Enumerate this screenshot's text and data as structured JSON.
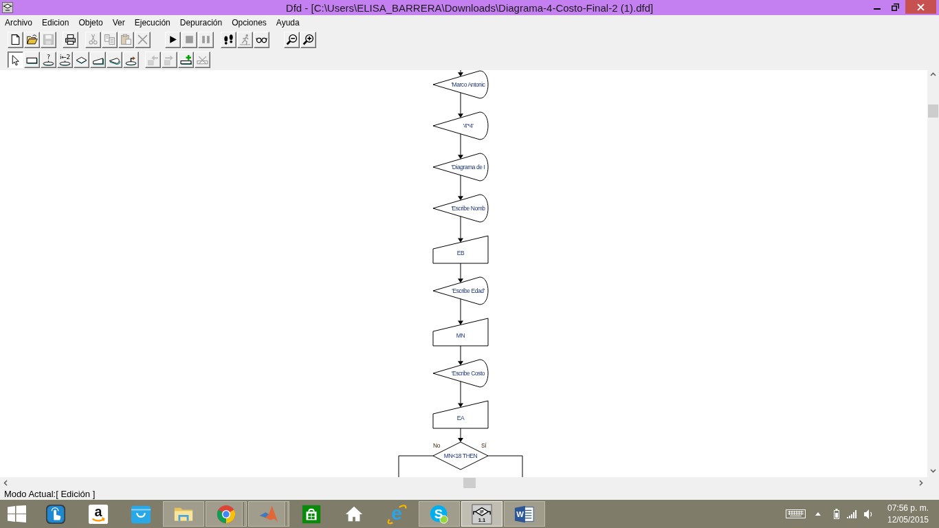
{
  "window": {
    "title": "Dfd - [C:\\Users\\ELISA_BARRERA\\Downloads\\Diagrama-4-Costo-Final-2 (1).dfd]"
  },
  "menu": [
    "Archivo",
    "Edicion",
    "Objeto",
    "Ver",
    "Ejecución",
    "Depuración",
    "Opciones",
    "Ayuda"
  ],
  "toolbar_main": [
    [
      {
        "disabled": false
      },
      {
        "disabled": false
      },
      {
        "disabled": true
      }
    ],
    [
      {
        "disabled": false
      }
    ],
    [
      {
        "disabled": true
      },
      {
        "disabled": true
      },
      {
        "disabled": true
      },
      {
        "disabled": true
      }
    ],
    [
      {
        "disabled": false
      },
      {
        "disabled": true
      },
      {
        "disabled": true
      }
    ],
    [
      {
        "disabled": false
      },
      {
        "disabled": true
      },
      {
        "disabled": false
      }
    ],
    [
      {
        "disabled": false
      },
      {
        "disabled": false
      }
    ]
  ],
  "toolbar_objects": {
    "shapes": [
      {
        "selected": true
      },
      {
        "selected": false
      },
      {
        "selected": false,
        "label": "?"
      },
      {
        "selected": false,
        "label": "i←2"
      },
      {
        "selected": false
      },
      {
        "selected": false
      },
      {
        "selected": false
      },
      {
        "selected": false
      }
    ],
    "edit": [
      {
        "disabled": true
      },
      {
        "disabled": true
      },
      {
        "disabled": false
      },
      {
        "disabled": true
      }
    ]
  },
  "canvas": {
    "nodes": [
      {
        "kind": "output",
        "text": "'Marco Antonic"
      },
      {
        "kind": "output",
        "text": "'4'*4'"
      },
      {
        "kind": "output",
        "text": "'Diagrama de I"
      },
      {
        "kind": "output",
        "text": "'Escribe Nomb"
      },
      {
        "kind": "input",
        "text": "EB"
      },
      {
        "kind": "output",
        "text": "'Escribe Edad'"
      },
      {
        "kind": "input",
        "text": "MN"
      },
      {
        "kind": "output",
        "text": "'Escribe Costo"
      },
      {
        "kind": "input",
        "text": "EA"
      },
      {
        "kind": "decision",
        "text": "MN<18 THEN",
        "no_label": "No",
        "yes_label": "Sí"
      }
    ]
  },
  "status_bar": {
    "text": "Modo Actual:[ Edición ]"
  },
  "taskbar": {
    "items": [
      {
        "running": false,
        "selected": false,
        "stacked": false
      },
      {
        "running": false,
        "selected": false,
        "stacked": false,
        "glyphs": [
          "a"
        ]
      },
      {
        "running": false,
        "selected": false,
        "stacked": false
      },
      {
        "running": true,
        "selected": false,
        "stacked": false
      },
      {
        "running": true,
        "selected": false,
        "stacked": true
      },
      {
        "running": true,
        "selected": false,
        "stacked": true
      },
      {
        "running": false,
        "selected": false,
        "stacked": false
      },
      {
        "running": false,
        "selected": false,
        "stacked": false
      },
      {
        "running": false,
        "selected": false,
        "stacked": false,
        "glyphs": [
          "e"
        ]
      },
      {
        "running": true,
        "selected": false,
        "stacked": false,
        "glyphs": [
          "S"
        ]
      },
      {
        "running": true,
        "selected": true,
        "stacked": false,
        "glyphs": [
          "IF",
          "1.1"
        ]
      },
      {
        "running": true,
        "selected": false,
        "stacked": false,
        "glyphs": [
          "W"
        ]
      }
    ],
    "clock": {
      "time": "07:56 p. m.",
      "date": "12/05/2015"
    }
  }
}
